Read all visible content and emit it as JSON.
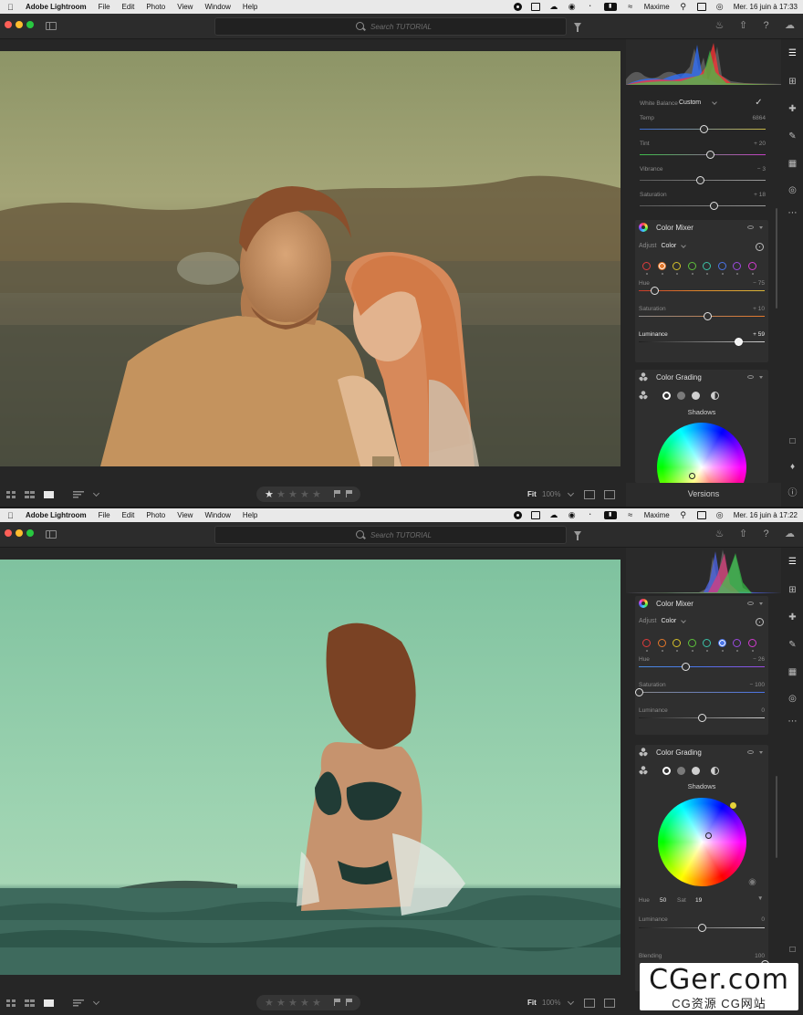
{
  "menubar": {
    "app_name": "Adobe Lightroom",
    "menus": [
      "File",
      "Edit",
      "Photo",
      "View",
      "Window",
      "Help"
    ],
    "user": "Maxime"
  },
  "screens": [
    {
      "clock": "Mer. 16 juin à 17:33",
      "search_placeholder": "Search TUTORIAL",
      "zoom_label": "Fit",
      "zoom_value": "100%",
      "panel_tab": "Versions",
      "rating": 1,
      "white_balance": {
        "label": "White Balance",
        "value": "Custom"
      },
      "light_sliders": [
        {
          "label": "Temp",
          "value": "6864",
          "level": 0.51
        },
        {
          "label": "Tint",
          "value": "+ 20",
          "level": 0.56
        },
        {
          "label": "Vibrance",
          "value": "− 3",
          "level": 0.48
        },
        {
          "label": "Saturation",
          "value": "+ 18",
          "level": 0.59
        }
      ],
      "color_mixer": {
        "title": "Color Mixer",
        "adjust_label": "Adjust",
        "adjust_value": "Color",
        "selected_swatch": 1,
        "sliders": [
          {
            "label": "Hue",
            "value": "− 75",
            "level": 0.13
          },
          {
            "label": "Saturation",
            "value": "+ 10",
            "level": 0.55
          },
          {
            "label": "Luminance",
            "value": "+ 59",
            "level": 0.79
          }
        ]
      },
      "color_grading": {
        "title": "Color Grading",
        "wheel_label": "Shadows"
      }
    },
    {
      "clock": "Mer. 16 juin à 17:22",
      "search_placeholder": "Search TUTORIAL",
      "zoom_label": "Fit",
      "zoom_value": "100%",
      "rating": 0,
      "color_mixer": {
        "title": "Color Mixer",
        "adjust_label": "Adjust",
        "adjust_value": "Color",
        "selected_swatch": 5,
        "sliders": [
          {
            "label": "Hue",
            "value": "− 26",
            "level": 0.37
          },
          {
            "label": "Saturation",
            "value": "− 100",
            "level": 0.0
          },
          {
            "label": "Luminance",
            "value": "0",
            "level": 0.5
          }
        ]
      },
      "color_grading": {
        "title": "Color Grading",
        "wheel_label": "Shadows",
        "hue_label": "Hue",
        "hue_value": "50",
        "sat_label": "Sat",
        "sat_value": "19",
        "sliders": [
          {
            "label": "Luminance",
            "value": "0",
            "level": 0.5
          },
          {
            "label": "Blending",
            "value": "100",
            "level": 1.0
          }
        ]
      }
    }
  ],
  "swatch_colors": [
    "#e03b3b",
    "#e5782a",
    "#d6c12a",
    "#5cc23a",
    "#3ac2a8",
    "#4a74e8",
    "#9a4ae0",
    "#d23ad0"
  ],
  "icons": {
    "rail": [
      "sliders-icon",
      "crop-icon",
      "healing-icon",
      "brush-icon",
      "gradient-icon",
      "radial-icon",
      "more-icon"
    ],
    "rail_bottom": [
      "comment-icon",
      "tag-icon",
      "info-icon"
    ]
  },
  "watermark": {
    "main": "CGer.com",
    "sub": "CG资源 CG网站"
  }
}
